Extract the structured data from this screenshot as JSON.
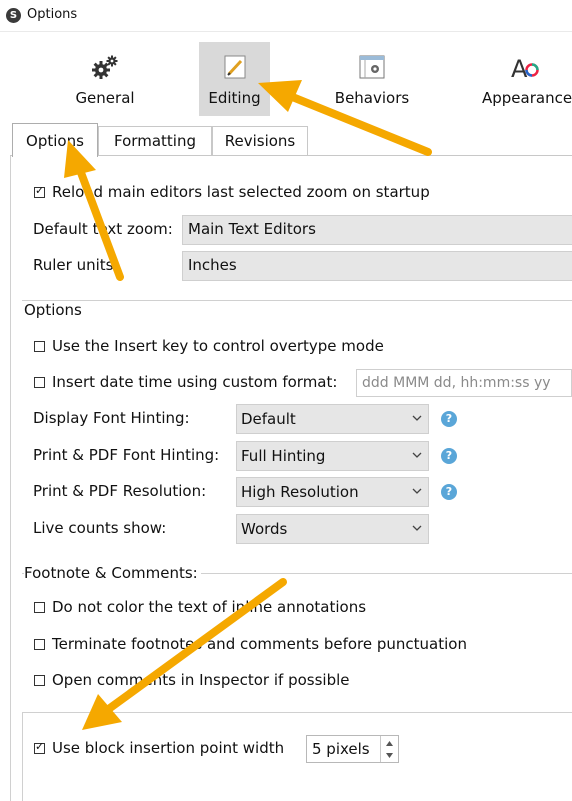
{
  "window": {
    "title": "Options",
    "app_icon": "scrivener-icon"
  },
  "toolbar": {
    "items": [
      {
        "label": "General",
        "icon": "gears-icon"
      },
      {
        "label": "Editing",
        "icon": "pencil-page-icon",
        "selected": true
      },
      {
        "label": "Behaviors",
        "icon": "window-gear-icon"
      },
      {
        "label": "Appearance",
        "icon": "font-color-icon"
      }
    ]
  },
  "tabs": [
    {
      "label": "Options",
      "active": true
    },
    {
      "label": "Formatting"
    },
    {
      "label": "Revisions"
    }
  ],
  "zoom": {
    "reload_label": "Reload main editors last selected zoom on startup",
    "reload_checked": true,
    "default_zoom_label": "Default text zoom:",
    "default_zoom_value": "Main Text Editors",
    "ruler_units_label": "Ruler units:",
    "ruler_units_value": "Inches"
  },
  "options_section": {
    "title": "Options",
    "insert_key_label": "Use the Insert key to control overtype mode",
    "insert_date_label": "Insert date time using custom format:",
    "date_format_placeholder": "ddd MMM dd, hh:mm:ss yy",
    "display_hinting_label": "Display Font Hinting:",
    "display_hinting_value": "Default",
    "print_hinting_label": "Print & PDF Font Hinting:",
    "print_hinting_value": "Full Hinting",
    "print_resolution_label": "Print & PDF Resolution:",
    "print_resolution_value": "High Resolution",
    "live_counts_label": "Live counts show:",
    "live_counts_value": "Words",
    "help_glyph": "?"
  },
  "footnote_section": {
    "title": "Footnote & Comments:",
    "no_color_label": "Do not color the text of inline annotations",
    "terminate_label": "Terminate footnotes and comments before punctuation",
    "open_comments_label": "Open comments in Inspector if possible"
  },
  "block_insertion": {
    "label": "Use block insertion point width",
    "checked": true,
    "value": "5 pixels"
  },
  "colors": {
    "annotation_arrow": "#f5a800",
    "selected_toolbar": "#d9d9d9",
    "help_icon": "#5aa6d8"
  }
}
